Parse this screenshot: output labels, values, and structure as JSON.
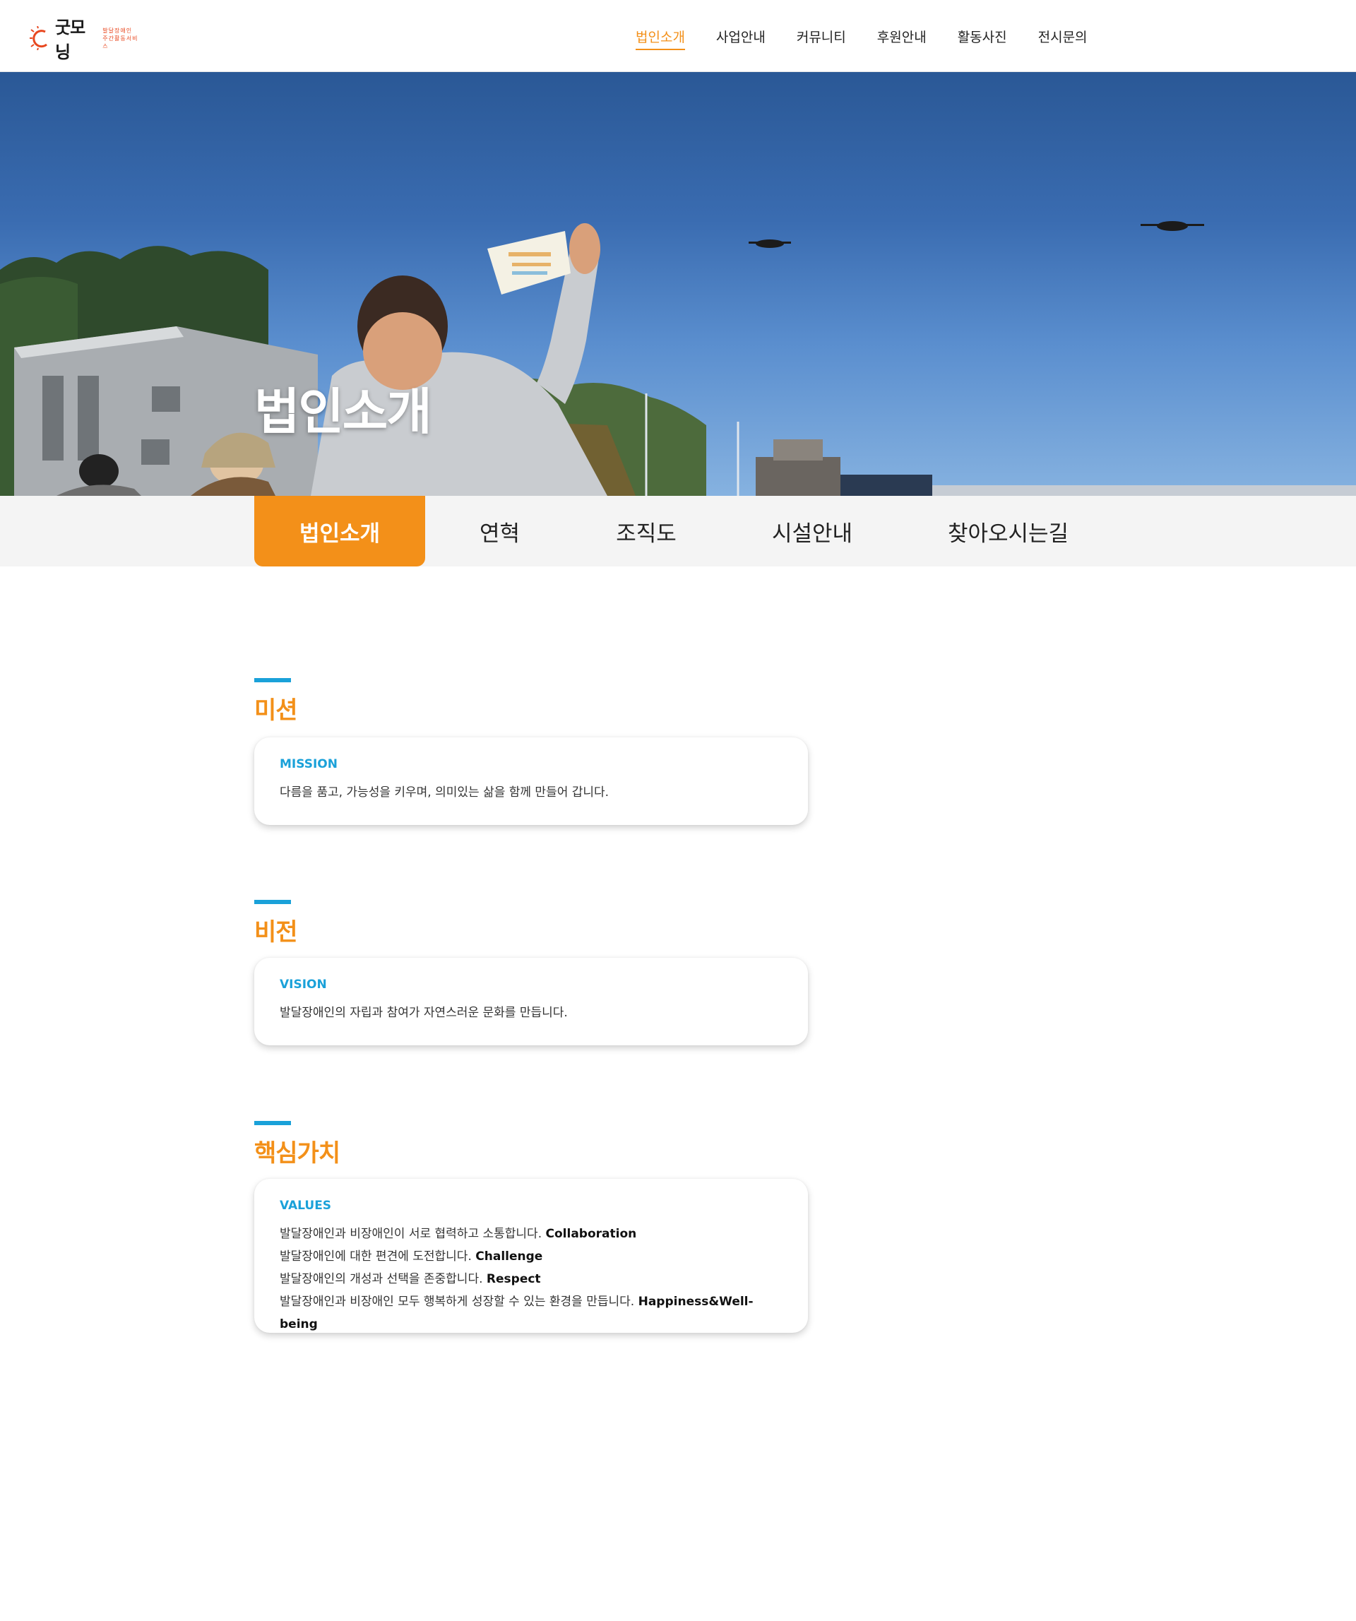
{
  "logo": {
    "name": "굿모닝",
    "sub_line1": "발달장애인",
    "sub_line2": "주간활동서비스"
  },
  "gnb": [
    "법인소개",
    "사업안내",
    "커뮤니티",
    "후원안내",
    "활동사진",
    "전시문의"
  ],
  "hero": {
    "title": "법인소개"
  },
  "subnav": [
    "법인소개",
    "연혁",
    "조직도",
    "시설안내",
    "찾아오시는길"
  ],
  "sections": {
    "mission": {
      "title": "미션",
      "label": "MISSION",
      "text": "다름을 품고, 가능성을 키우며, 의미있는 삶을 함께 만들어 갑니다."
    },
    "vision": {
      "title": "비전",
      "label": "VISION",
      "text": "발달장애인의 자립과 참여가 자연스러운 문화를 만듭니다."
    },
    "values": {
      "title": "핵심가치",
      "label": "VALUES",
      "items": [
        {
          "text": "발달장애인과 비장애인이 서로 협력하고 소통합니다.",
          "keyword": "Collaboration"
        },
        {
          "text": "발달장애인에 대한 편견에 도전합니다.",
          "keyword": "Challenge"
        },
        {
          "text": "발달장애인의 개성과 선택을 존중합니다.",
          "keyword": "Respect"
        },
        {
          "text": "발달장애인과 비장애인 모두 행복하게 성장할 수 있는 환경을 만듭니다.",
          "keyword": "Happiness&Well-being"
        }
      ]
    }
  },
  "colors": {
    "accent": "#f39019",
    "secondary": "#1aa1d9"
  }
}
